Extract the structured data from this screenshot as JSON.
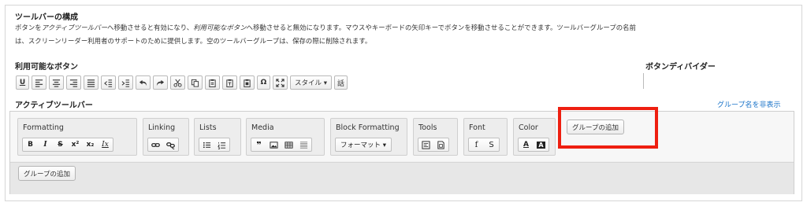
{
  "config": {
    "title": "ツールバーの構成",
    "description_parts": [
      "ボタンを",
      "アクティブツールバー",
      "へ移動させると有効になり、",
      "利用可能なボタン",
      "へ移動させると無効になります。マウスやキーボードの矢印キーでボタンを移動させることができます。ツールバーグループの名前",
      "は、スクリーンリーダー利用者のサポートのために提供します。空のツールバーグループは、保存の際に削除されます。"
    ]
  },
  "available": {
    "title": "利用可能なボタン",
    "buttons": [
      {
        "icon": "underline-icon",
        "label": "U"
      },
      {
        "icon": "align-left-icon"
      },
      {
        "icon": "align-center-icon"
      },
      {
        "icon": "align-right-icon"
      },
      {
        "icon": "align-justify-icon"
      },
      {
        "icon": "outdent-icon"
      },
      {
        "icon": "indent-icon"
      },
      {
        "icon": "undo-icon"
      },
      {
        "icon": "redo-icon"
      },
      {
        "icon": "cut-icon"
      },
      {
        "icon": "copy-icon"
      },
      {
        "icon": "paste-icon"
      },
      {
        "icon": "paste-text-icon"
      },
      {
        "icon": "paste-word-icon"
      },
      {
        "icon": "special-char-icon",
        "label": "Ω"
      },
      {
        "icon": "maximize-icon"
      },
      {
        "icon": "style-dropdown-icon",
        "label": "スタイル ▾"
      },
      {
        "icon": "language-icon",
        "label": "話"
      }
    ]
  },
  "divider": {
    "title": "ボタンディバイダー"
  },
  "active": {
    "title": "アクティブツールバー",
    "toggle_link": "グループ名を非表示",
    "groups": [
      {
        "name": "Formatting",
        "buttons": [
          {
            "icon": "bold-icon",
            "label": "B"
          },
          {
            "icon": "italic-icon",
            "label": "I"
          },
          {
            "icon": "strikethrough-icon",
            "label": "S"
          },
          {
            "icon": "superscript-icon",
            "label": "x²"
          },
          {
            "icon": "subscript-icon",
            "label": "x₂"
          },
          {
            "icon": "remove-format-icon",
            "label": "Ix"
          }
        ]
      },
      {
        "name": "Linking",
        "buttons": [
          {
            "icon": "link-icon"
          },
          {
            "icon": "unlink-icon"
          }
        ]
      },
      {
        "name": "Lists",
        "buttons": [
          {
            "icon": "bulleted-list-icon"
          },
          {
            "icon": "numbered-list-icon"
          }
        ]
      },
      {
        "name": "Media",
        "buttons": [
          {
            "icon": "blockquote-icon",
            "label": "❞"
          },
          {
            "icon": "image-icon"
          },
          {
            "icon": "table-icon"
          },
          {
            "icon": "horizontal-line-icon"
          }
        ]
      },
      {
        "name": "Block Formatting",
        "buttons": [
          {
            "icon": "format-dropdown-icon",
            "label": "フォーマット ▾"
          }
        ]
      },
      {
        "name": "Tools",
        "buttons": [
          {
            "icon": "source-icon"
          },
          {
            "icon": "show-blocks-icon"
          }
        ]
      },
      {
        "name": "Font",
        "buttons": [
          {
            "icon": "font-icon",
            "label": "f"
          },
          {
            "icon": "font-size-icon",
            "label": "S"
          }
        ]
      },
      {
        "name": "Color",
        "buttons": [
          {
            "icon": "text-color-icon",
            "label": "A"
          },
          {
            "icon": "bg-color-icon",
            "label": "A"
          }
        ]
      }
    ],
    "add_group_label_row1": "グループの追加",
    "add_group_label_row2": "グループの追加"
  },
  "colors": {
    "highlight": "#ee1f10",
    "link": "#1a73c8"
  }
}
